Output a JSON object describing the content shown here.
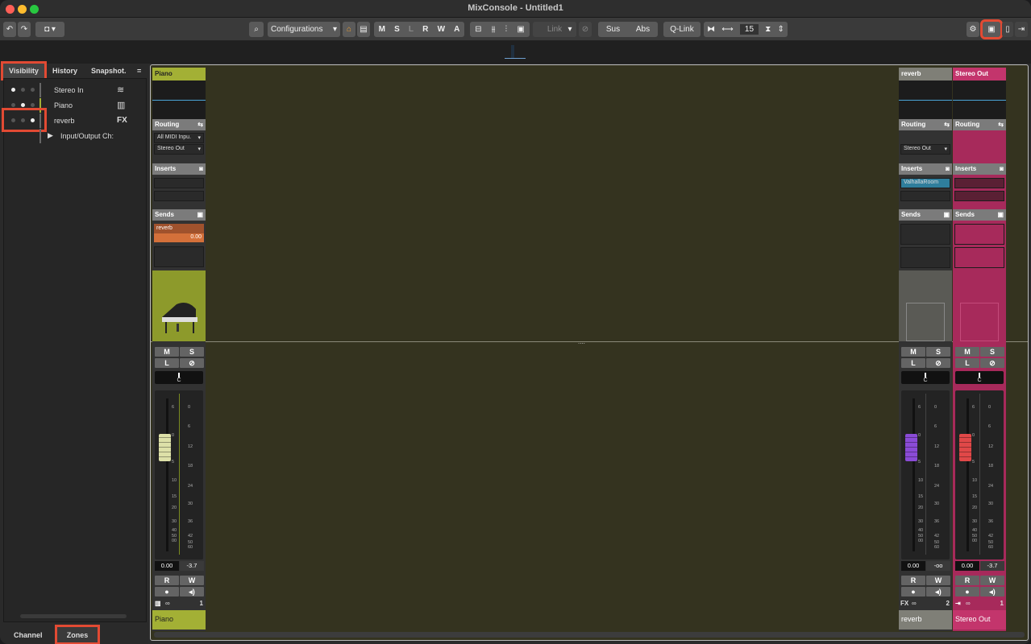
{
  "window": {
    "title": "MixConsole - Untitled1"
  },
  "toolbar": {
    "configurations_label": "Configurations",
    "mute_label": "M",
    "solo_label": "S",
    "listen_label": "L",
    "read_label": "R",
    "write_label": "W",
    "a_label": "A",
    "link_label": "Link",
    "sus_label": "Sus",
    "abs_label": "Abs",
    "qlink_label": "Q-Link",
    "channel_width_value": "15"
  },
  "left_panel": {
    "tabs": {
      "visibility": "Visibility",
      "history": "History",
      "snapshots": "Snapshot.",
      "menu": "="
    },
    "items": [
      {
        "label": "Stereo In",
        "icon": "waveform-icon"
      },
      {
        "label": "Piano",
        "icon": "piano-icon"
      },
      {
        "label": "reverb",
        "icon": "fx-icon",
        "icon_text": "FX"
      },
      {
        "label": "Input/Output Ch:"
      }
    ],
    "bottom_tabs": {
      "channel": "Channel",
      "zones": "Zones"
    }
  },
  "channels": [
    {
      "name": "Piano",
      "color": "#a3b035",
      "routing_label": "Routing",
      "input": "All MIDI Inpu.",
      "output": "Stereo Out",
      "inserts_label": "Inserts",
      "sends_label": "Sends",
      "send_name": "reverb",
      "send_value": "0.00",
      "pan": "C",
      "mute": "M",
      "solo": "S",
      "listen": "L",
      "volume": "0.00",
      "peak": "-3.7",
      "read": "R",
      "write": "W",
      "number": "1",
      "fader_level": 0.73,
      "cap_color": "#dde0a8"
    },
    {
      "name": "reverb",
      "color": "#7f7f77",
      "routing_label": "Routing",
      "output": "Stereo Out",
      "inserts_label": "Inserts",
      "insert_1": "ValhallaRoom",
      "sends_label": "Sends",
      "pan": "C",
      "mute": "M",
      "solo": "S",
      "listen": "L",
      "volume": "0.00",
      "peak": "-oo",
      "read": "R",
      "write": "W",
      "number": "2",
      "type_label": "FX",
      "fader_level": 0.73,
      "cap_color": "#8a4bd6"
    },
    {
      "name": "Stereo Out",
      "color": "#c3356c",
      "routing_label": "Routing",
      "inserts_label": "Inserts",
      "sends_label": "Sends",
      "pan": "C",
      "mute": "M",
      "solo": "S",
      "listen": "L",
      "volume": "0.00",
      "peak": "-3.7",
      "read": "R",
      "write": "W",
      "number": "1",
      "fader_level": 0.73,
      "cap_color": "#e04848"
    }
  ],
  "scale_left": [
    "6",
    "0",
    "5",
    "10",
    "15",
    "20",
    "30",
    "40",
    "50",
    "00"
  ],
  "scale_right": [
    "0",
    "6",
    "12",
    "18",
    "24",
    "30",
    "36",
    "42",
    "50",
    "60"
  ]
}
